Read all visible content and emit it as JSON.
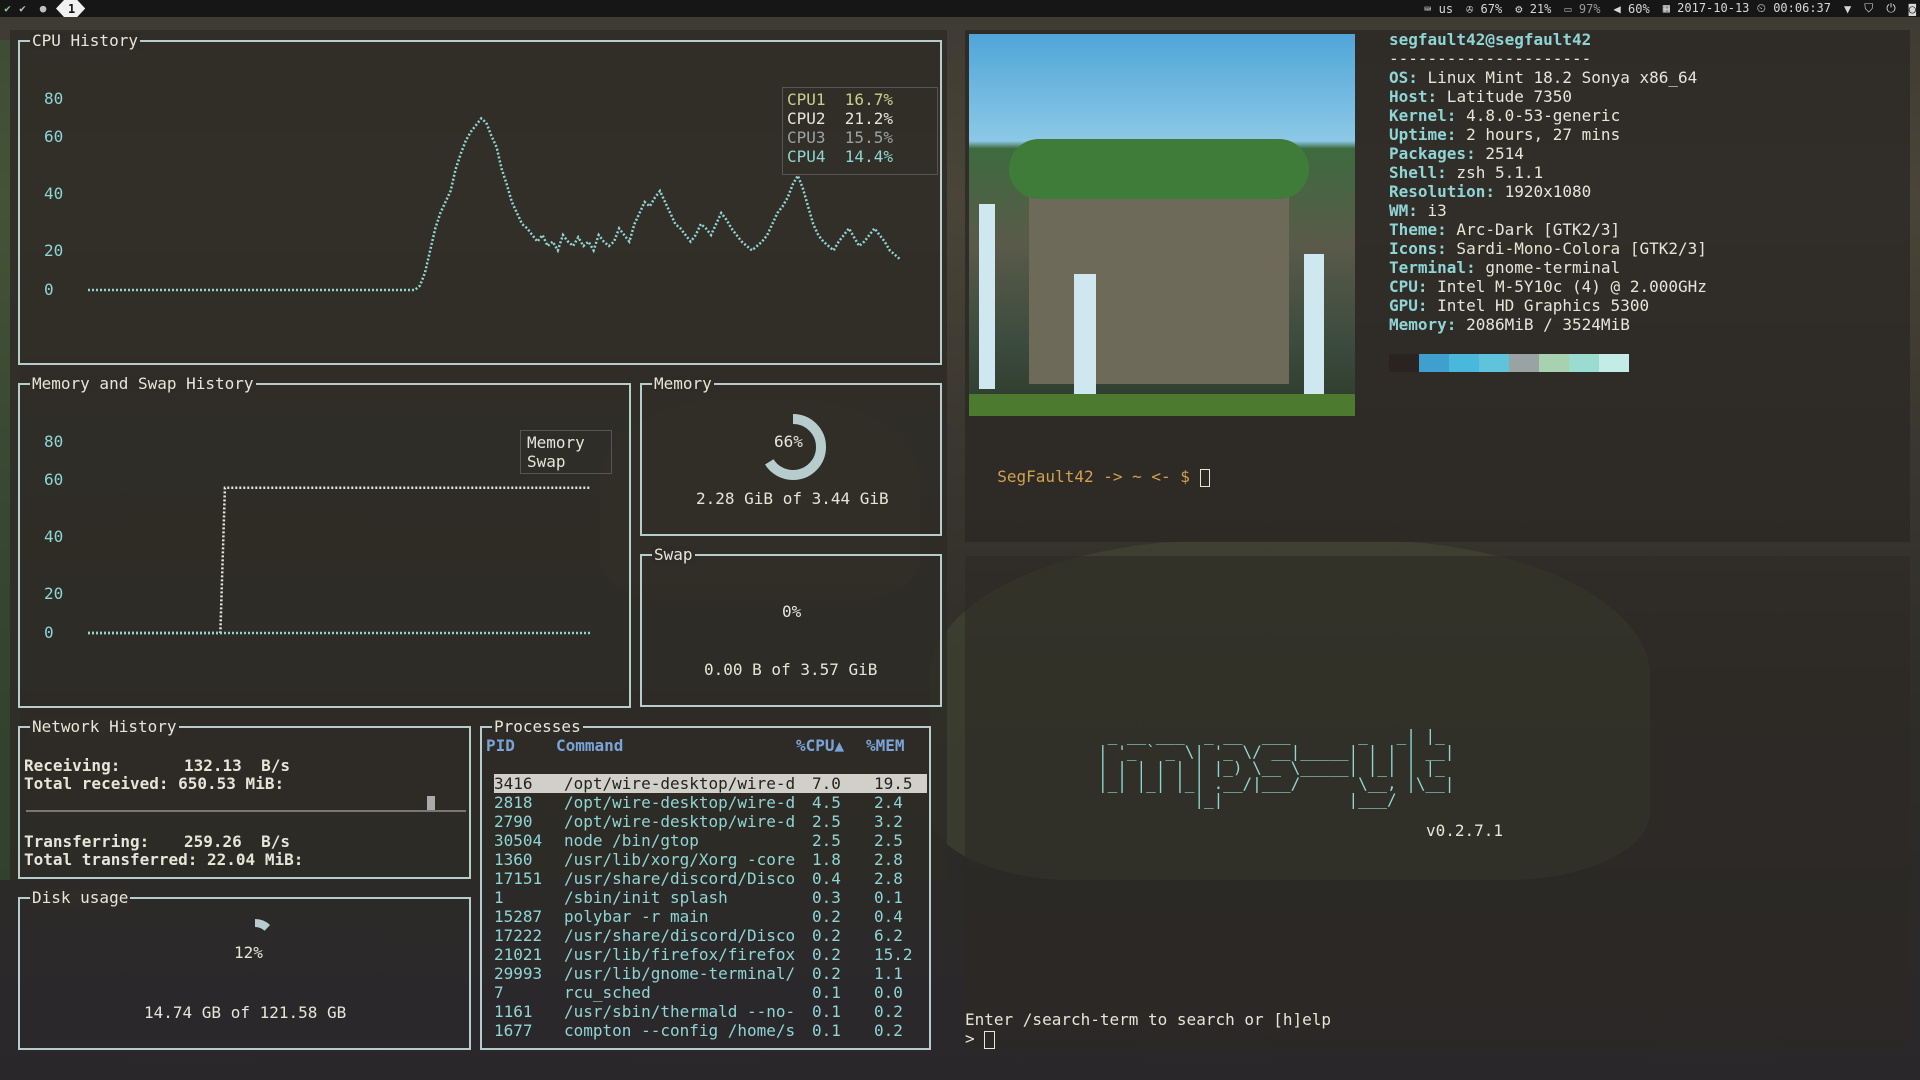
{
  "topbar": {
    "workspace": "1",
    "layout": "us",
    "fan": "67%",
    "cpu": "21%",
    "battery": "97%",
    "volume": "60%",
    "datetime": "2017-10-13 ⏲ 00:06:37"
  },
  "gtop": {
    "cpu_history": {
      "title": "CPU History",
      "yticks": [
        "80",
        "60",
        "40",
        "20",
        "0"
      ],
      "legend": [
        {
          "name": "CPU1",
          "value": "16.7%",
          "color": "#c8d08e"
        },
        {
          "name": "CPU2",
          "value": "21.2%",
          "color": "#e6e6d8"
        },
        {
          "name": "CPU3",
          "value": "15.5%",
          "color": "#9aa3a3"
        },
        {
          "name": "CPU4",
          "value": "14.4%",
          "color": "#8fd5d5"
        }
      ],
      "series": [
        {
          "name": "CPU4",
          "values": [
            0,
            0,
            0,
            0,
            0,
            0,
            0,
            0,
            0,
            0,
            0,
            0,
            0,
            0,
            0,
            0,
            0,
            0,
            0,
            0,
            0,
            0,
            0,
            0,
            0,
            0,
            0,
            0,
            0,
            0,
            0,
            0,
            0,
            0,
            0,
            0,
            0,
            0,
            0,
            0,
            0,
            0,
            0,
            0,
            0,
            0,
            0,
            0,
            0,
            0,
            0,
            0,
            0,
            0,
            0,
            0,
            0,
            0,
            0,
            0,
            0,
            0,
            0,
            0,
            0,
            2,
            8,
            18,
            28,
            35,
            40,
            45,
            55,
            62,
            68,
            72,
            75,
            78,
            76,
            70,
            65,
            55,
            48,
            40,
            35,
            30,
            28,
            25,
            22,
            25,
            20,
            22,
            18,
            25,
            22,
            20,
            24,
            20,
            22,
            18,
            25,
            22,
            20,
            22,
            28,
            25,
            22,
            30,
            35,
            40,
            38,
            42,
            45,
            40,
            35,
            30,
            28,
            25,
            22,
            25,
            30,
            28,
            25,
            30,
            35,
            32,
            28,
            25,
            22,
            20,
            18,
            20,
            22,
            25,
            30,
            35,
            38,
            42,
            48,
            52,
            46,
            38,
            30,
            25,
            22,
            20,
            18,
            22,
            25,
            28,
            24,
            20,
            22,
            25,
            28,
            25,
            22,
            18,
            16,
            14
          ]
        }
      ]
    },
    "mem_history": {
      "title": "Memory and Swap History",
      "yticks": [
        "80",
        "60",
        "40",
        "20",
        "0"
      ],
      "legend": [
        "Memory",
        "Swap"
      ],
      "series": [
        {
          "name": "Memory",
          "values": [
            0,
            0,
            0,
            0,
            0,
            0,
            0,
            0,
            0,
            0,
            0,
            0,
            0,
            0,
            0,
            0,
            0,
            0,
            0,
            0,
            0,
            0,
            0,
            0,
            0,
            0,
            0,
            0,
            0,
            0,
            66,
            66,
            66,
            66,
            66,
            66,
            66,
            66,
            66,
            66,
            66,
            66,
            66,
            66,
            66,
            66,
            66,
            66,
            66,
            66,
            66,
            66,
            66,
            66,
            66,
            66,
            66,
            66,
            66,
            66,
            66,
            66,
            66,
            66,
            66,
            66,
            66,
            66,
            66,
            66,
            66,
            66,
            66,
            66,
            66,
            66,
            66,
            66,
            66,
            66,
            66,
            66,
            66,
            66,
            66,
            66,
            66,
            66,
            66,
            66,
            66,
            66,
            66,
            66,
            66,
            66,
            66,
            66,
            66,
            66,
            66,
            66,
            66,
            66,
            66,
            66,
            66,
            66,
            66,
            66,
            66
          ]
        },
        {
          "name": "Swap",
          "values": [
            0,
            0,
            0,
            0,
            0,
            0,
            0,
            0,
            0,
            0,
            0,
            0,
            0,
            0,
            0,
            0,
            0,
            0,
            0,
            0,
            0,
            0,
            0,
            0,
            0,
            0,
            0,
            0,
            0,
            0,
            0,
            0,
            0,
            0,
            0,
            0,
            0,
            0,
            0,
            0,
            0,
            0,
            0,
            0,
            0,
            0,
            0,
            0,
            0,
            0,
            0,
            0,
            0,
            0,
            0,
            0,
            0,
            0,
            0,
            0,
            0,
            0,
            0,
            0,
            0,
            0,
            0,
            0,
            0,
            0,
            0,
            0,
            0,
            0,
            0,
            0,
            0,
            0,
            0,
            0,
            0,
            0,
            0,
            0,
            0,
            0,
            0,
            0,
            0,
            0,
            0,
            0,
            0,
            0,
            0,
            0,
            0,
            0,
            0,
            0,
            0,
            0,
            0,
            0,
            0,
            0,
            0,
            0,
            0,
            0,
            0
          ]
        }
      ]
    },
    "memory": {
      "title": "Memory",
      "percent": "66%",
      "fraction": 0.66,
      "caption": "2.28 GiB of 3.44 GiB"
    },
    "swap": {
      "title": "Swap",
      "percent": "0%",
      "caption": "0.00 B of 3.57 GiB"
    },
    "network": {
      "title": "Network History",
      "receiving_label": "Receiving:",
      "receiving_value": "132.13  B/s",
      "total_received": "Total received: 650.53 MiB:",
      "transferring_label": "Transferring:",
      "transferring_value": "259.26  B/s",
      "total_transferred": "Total transferred: 22.04 MiB:"
    },
    "disk": {
      "title": "Disk usage",
      "percent": "12%",
      "fraction": 0.12,
      "caption": "14.74 GB of 121.58 GB"
    },
    "processes": {
      "title": "Processes",
      "headers": [
        "PID",
        "Command",
        "%CPU▲",
        "%MEM"
      ],
      "rows": [
        [
          "3416",
          "/opt/wire-desktop/wire-d",
          "7.0",
          "19.5"
        ],
        [
          "2818",
          "/opt/wire-desktop/wire-d",
          "4.5",
          "2.4"
        ],
        [
          "2790",
          "/opt/wire-desktop/wire-d",
          "2.5",
          "3.2"
        ],
        [
          "30504",
          "node /bin/gtop",
          "2.5",
          "2.5"
        ],
        [
          "1360",
          "/usr/lib/xorg/Xorg -core",
          "1.8",
          "2.8"
        ],
        [
          "17151",
          "/usr/share/discord/Disco",
          "0.4",
          "2.8"
        ],
        [
          "1",
          "/sbin/init splash",
          "0.3",
          "0.1"
        ],
        [
          "15287",
          "polybar -r main",
          "0.2",
          "0.4"
        ],
        [
          "17222",
          "/usr/share/discord/Disco",
          "0.2",
          "6.2"
        ],
        [
          "21021",
          "/usr/lib/firefox/firefox",
          "0.2",
          "15.2"
        ],
        [
          "29993",
          "/usr/lib/gnome-terminal/",
          "0.2",
          "1.1"
        ],
        [
          "7",
          "rcu_sched",
          "0.1",
          "0.0"
        ],
        [
          "1161",
          "/usr/sbin/thermald --no-",
          "0.1",
          "0.2"
        ],
        [
          "1677",
          "compton --config /home/s",
          "0.1",
          "0.2"
        ]
      ]
    }
  },
  "neofetch": {
    "userhost": "segfault42@segfault42",
    "separator": "---------------------",
    "info": [
      [
        "OS:",
        "Linux Mint 18.2 Sonya x86_64"
      ],
      [
        "Host:",
        "Latitude 7350"
      ],
      [
        "Kernel:",
        "4.8.0-53-generic"
      ],
      [
        "Uptime:",
        "2 hours, 27 mins"
      ],
      [
        "Packages:",
        "2514"
      ],
      [
        "Shell:",
        "zsh 5.1.1"
      ],
      [
        "Resolution:",
        "1920x1080"
      ],
      [
        "WM:",
        "i3"
      ],
      [
        "Theme:",
        "Arc-Dark [GTK2/3]"
      ],
      [
        "Icons:",
        "Sardi-Mono-Colora [GTK2/3]"
      ],
      [
        "Terminal:",
        "gnome-terminal"
      ],
      [
        "CPU:",
        "Intel M-5Y10c (4) @ 2.000GHz"
      ],
      [
        "GPU:",
        "Intel HD Graphics 5300"
      ],
      [
        "Memory:",
        "2086MiB / 3524MiB"
      ]
    ],
    "palette": [
      "#2a2322",
      "#3f9fce",
      "#4ab8da",
      "#5fc3dc",
      "#9aa3a3",
      "#a8d1b0",
      "#9bdcd0",
      "#c4ece6"
    ],
    "prompt": {
      "user": "SegFault42",
      "rest": " -> ~ <- $ "
    }
  },
  "mpsyt": {
    "logo": [
      " _ __ ___  _ __  ___       _   _| |_ ",
      "| '_ ` _ \\| '_ \\/ __|_____| | | | __|",
      "| | | | | | |_) \\__ \\_____| |_| | |_ ",
      "|_| |_| |_| .__/|___/      \\__, |\\__|",
      "          |_|             |___/     "
    ],
    "version": "v0.2.7.1",
    "help": "Enter /search-term to search or [h]elp",
    "prompt": ">"
  }
}
